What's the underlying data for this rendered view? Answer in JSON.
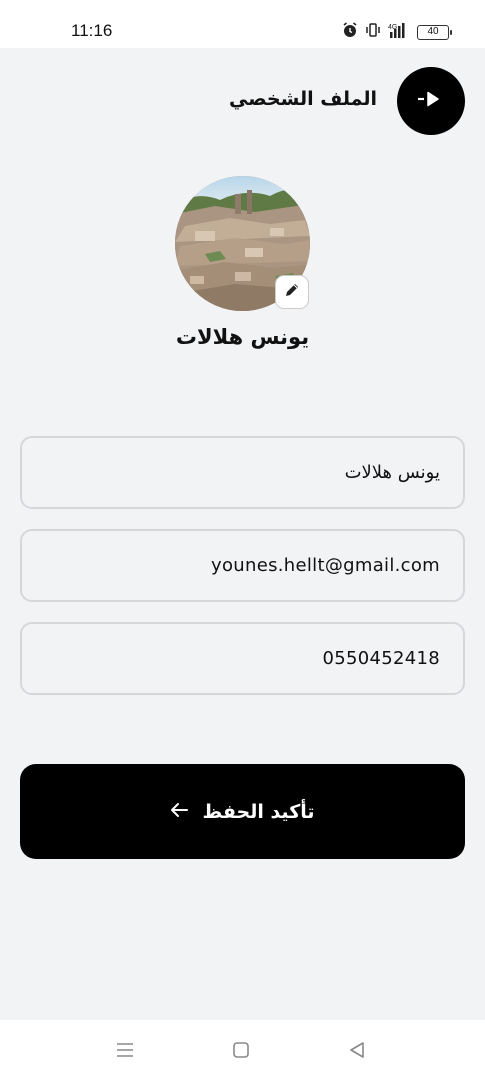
{
  "status_bar": {
    "time": "11:16",
    "battery": "40",
    "icons": [
      "alarm-icon",
      "vibrate-icon",
      "signal-icon",
      "battery-icon"
    ]
  },
  "header": {
    "title": "الملف الشخصي",
    "back_icon": "logout-arrow-icon"
  },
  "profile": {
    "name": "يونس هلالات",
    "edit_icon": "pencil-icon"
  },
  "form": {
    "name_value": "يونس هلالات",
    "email_value": "younes.hellt@gmail.com",
    "phone_value": "0550452418"
  },
  "actions": {
    "save_label": "تأكيد الحفظ",
    "save_icon": "arrow-left-icon"
  },
  "nav": {
    "items": [
      "menu-icon",
      "home-icon",
      "back-icon"
    ]
  },
  "colors": {
    "background": "#f2f3f5",
    "primary": "#000000",
    "field_border": "#d5d7db"
  }
}
